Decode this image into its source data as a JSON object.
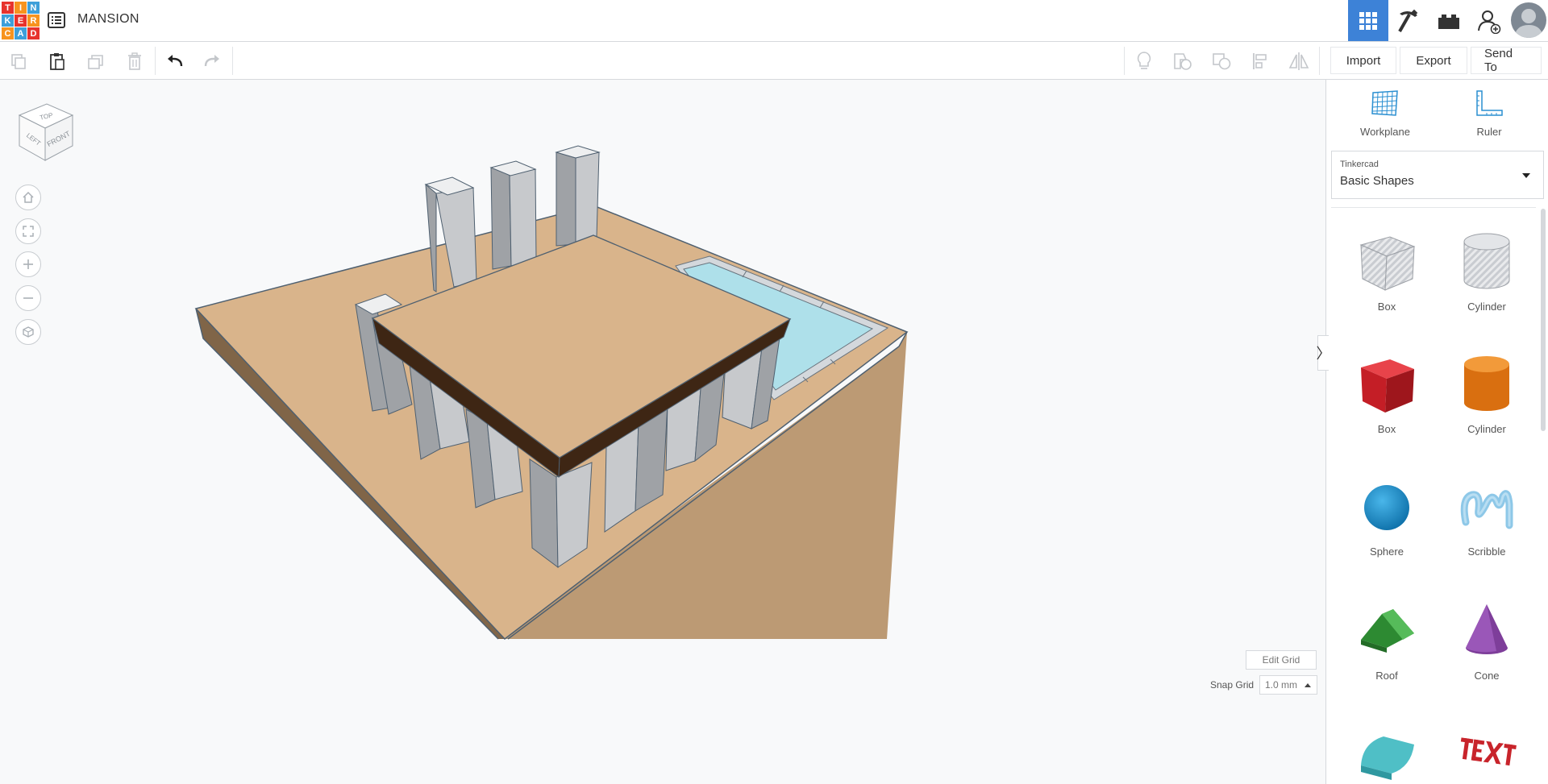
{
  "app": {
    "logo_letters": [
      "T",
      "I",
      "N",
      "K",
      "E",
      "R",
      "C",
      "A",
      "D"
    ],
    "logo_colors": [
      "#e7332d",
      "#f7931e",
      "#3e9fd9",
      "#3e9fd9",
      "#e7332d",
      "#f7931e",
      "#f7931e",
      "#3e9fd9",
      "#e7332d"
    ],
    "design_title": "MANSION",
    "accent_color": "#3d82d7"
  },
  "header": {
    "buttons": [
      {
        "name": "3d-design-view",
        "icon": "grid-icon",
        "active": true
      },
      {
        "name": "blocks-view",
        "icon": "pickaxe-icon",
        "active": false
      },
      {
        "name": "bricks-view",
        "icon": "brick-icon",
        "active": false
      },
      {
        "name": "invite-people",
        "icon": "add-user-icon",
        "active": false
      }
    ]
  },
  "toolbar": {
    "left_tools": [
      "copy-icon",
      "paste-icon",
      "duplicate-icon",
      "delete-icon",
      "undo-icon",
      "redo-icon"
    ],
    "right_tools": [
      "notes-icon",
      "group-icon",
      "ungroup-icon",
      "align-icon",
      "mirror-icon"
    ],
    "import_label": "Import",
    "export_label": "Export",
    "send_to_label": "Send To"
  },
  "viewcube": {
    "top": "TOP",
    "left": "LEFT",
    "front": "FRONT"
  },
  "nav_controls": [
    "home-icon",
    "fit-view-icon",
    "zoom-in-icon",
    "zoom-out-icon",
    "perspective-icon"
  ],
  "grid": {
    "edit_grid_label": "Edit Grid",
    "snap_grid_label": "Snap Grid",
    "snap_value": "1.0 mm"
  },
  "panel": {
    "workplane_label": "Workplane",
    "ruler_label": "Ruler",
    "library_provider": "Tinkercad",
    "library_name": "Basic Shapes",
    "shapes": [
      {
        "label": "Box",
        "kind": "hole-box"
      },
      {
        "label": "Cylinder",
        "kind": "hole-cylinder"
      },
      {
        "label": "Box",
        "kind": "box"
      },
      {
        "label": "Cylinder",
        "kind": "cylinder"
      },
      {
        "label": "Sphere",
        "kind": "sphere"
      },
      {
        "label": "Scribble",
        "kind": "scribble"
      },
      {
        "label": "Roof",
        "kind": "roof"
      },
      {
        "label": "Cone",
        "kind": "cone"
      },
      {
        "label": "",
        "kind": "round-roof"
      },
      {
        "label": "",
        "kind": "text"
      }
    ],
    "colors": {
      "box": "#d42a2f",
      "cylinder": "#e8821c",
      "sphere": "#1b94d4",
      "scribble": "#8ec8e8",
      "roof": "#3aa33f",
      "cone": "#7e3e9a",
      "round-roof": "#4fbfc6",
      "text": "#c8242b"
    }
  },
  "scene_colors": {
    "base_top": "#d9b48b",
    "base_left": "#806548",
    "base_front": "#bc9a74",
    "pillar_front": "#c7c9cc",
    "pillar_side": "#9fa2a6",
    "pillar_top": "#eeeff0",
    "roof_band": "#3e2614",
    "pool_water": "#aee0ea",
    "pool_rim": "#d4d8dc"
  }
}
